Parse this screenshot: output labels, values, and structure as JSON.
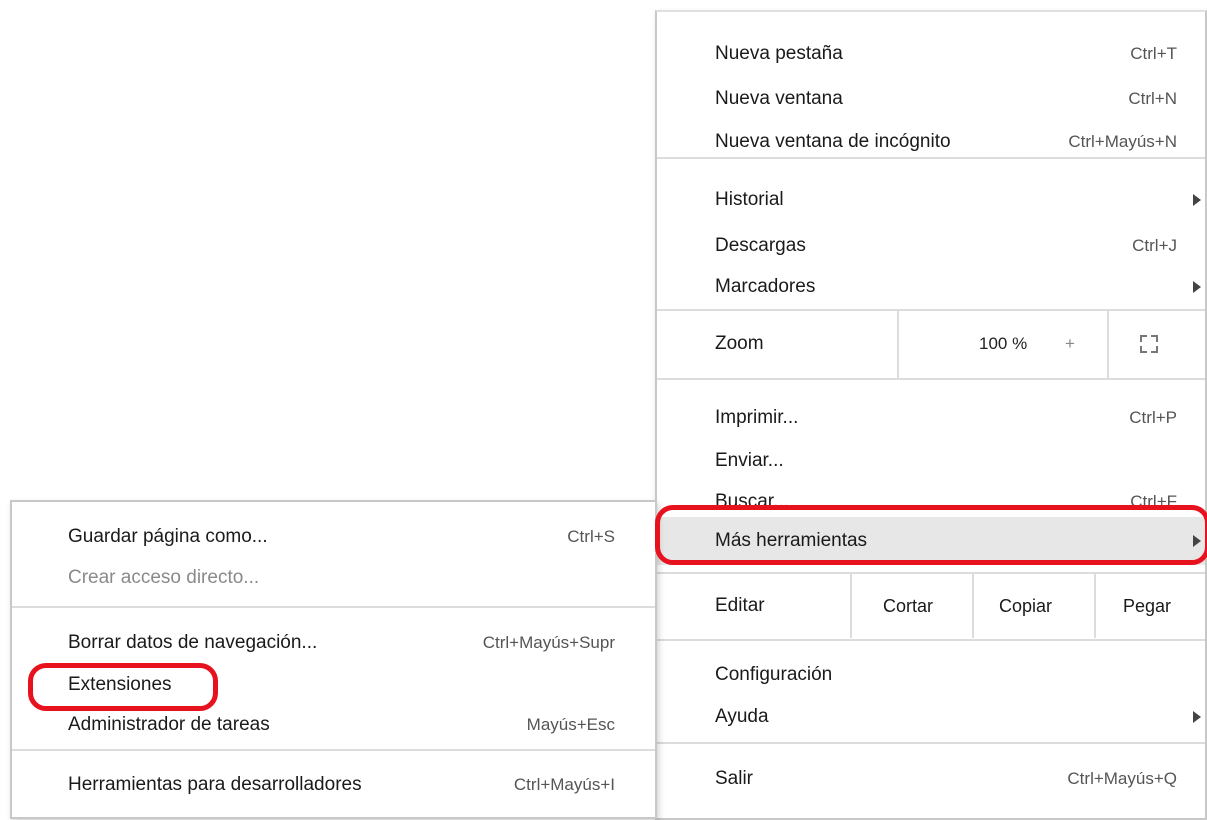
{
  "main_menu": {
    "items": [
      {
        "label": "Nueva pestaña",
        "shortcut": "Ctrl+T"
      },
      {
        "label": "Nueva ventana",
        "shortcut": "Ctrl+N"
      },
      {
        "label": "Nueva ventana de incógnito",
        "shortcut": "Ctrl+Mayús+N"
      },
      {
        "label": "Historial",
        "shortcut": ""
      },
      {
        "label": "Descargas",
        "shortcut": "Ctrl+J"
      },
      {
        "label": "Marcadores",
        "shortcut": ""
      },
      {
        "label": "Imprimir...",
        "shortcut": "Ctrl+P"
      },
      {
        "label": "Enviar...",
        "shortcut": ""
      },
      {
        "label": "Buscar...",
        "shortcut": "Ctrl+F"
      },
      {
        "label": "Más herramientas",
        "shortcut": ""
      },
      {
        "label": "Configuración",
        "shortcut": ""
      },
      {
        "label": "Ayuda",
        "shortcut": ""
      },
      {
        "label": "Salir",
        "shortcut": "Ctrl+Mayús+Q"
      }
    ],
    "zoom": {
      "label": "Zoom",
      "value": "100 %",
      "plus": "+"
    },
    "edit": {
      "label": "Editar",
      "cut": "Cortar",
      "copy": "Copiar",
      "paste": "Pegar"
    }
  },
  "sub_menu": {
    "items": [
      {
        "label": "Guardar página como...",
        "shortcut": "Ctrl+S"
      },
      {
        "label": "Crear acceso directo...",
        "shortcut": ""
      },
      {
        "label": "Borrar datos de navegación...",
        "shortcut": "Ctrl+Mayús+Supr"
      },
      {
        "label": "Extensiones",
        "shortcut": ""
      },
      {
        "label": "Administrador de tareas",
        "shortcut": "Mayús+Esc"
      },
      {
        "label": "Herramientas para desarrolladores",
        "shortcut": "Ctrl+Mayús+I"
      }
    ]
  },
  "colors": {
    "highlight_ring": "#e8121f",
    "hover_row": "#e7e7e7"
  }
}
